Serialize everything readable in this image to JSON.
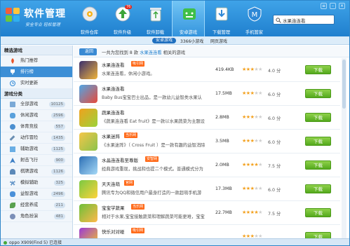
{
  "app": {
    "title": "软件管理",
    "slogan": "安全专业 轻松管理"
  },
  "tabs": [
    {
      "label": "软件仓库",
      "icon": "disc-icon"
    },
    {
      "label": "软件升级",
      "icon": "upgrade-icon",
      "badge": "76"
    },
    {
      "label": "软件卸载",
      "icon": "recycle-bin-icon"
    },
    {
      "label": "安卓游戏",
      "icon": "android-game-icon",
      "active": true
    },
    {
      "label": "下载管理",
      "icon": "download-icon"
    },
    {
      "label": "手机管家",
      "icon": "phone-manager-icon"
    }
  ],
  "search": {
    "value": "水果连连看"
  },
  "subbar": {
    "safe_label": "安卓游戏",
    "count_label": "3366小游戏",
    "web_label": "网页游戏"
  },
  "sidebar": {
    "section1": "精选游戏",
    "featured": [
      {
        "label": "热门推荐"
      },
      {
        "label": "排行榜",
        "selected": true
      },
      {
        "label": "实时更新"
      }
    ],
    "section2": "游戏分类",
    "categories": [
      {
        "label": "全部游戏",
        "count": "10125"
      },
      {
        "label": "休闲游戏",
        "count": "2596"
      },
      {
        "label": "体育竞技",
        "count": "557"
      },
      {
        "label": "动作冒险",
        "count": "1435"
      },
      {
        "label": "辅助游戏",
        "count": "1125"
      },
      {
        "label": "射击飞行",
        "count": "900"
      },
      {
        "label": "棋牌游戏",
        "count": "1126"
      },
      {
        "label": "模拟辅助",
        "count": "325"
      },
      {
        "label": "益智游戏",
        "count": "2496"
      },
      {
        "label": "经营养成",
        "count": "211"
      },
      {
        "label": "角色扮演",
        "count": "481"
      }
    ]
  },
  "crumb": {
    "back": "返回",
    "prefix": "一共为您找到 8 款",
    "keyword": "水果连连看",
    "suffix": "相关的游戏"
  },
  "apps": [
    {
      "name": "水果连连看",
      "tag": "吸引网",
      "desc": "水果连连看，休闲小游戏。",
      "size": "419.4KB",
      "rating": 3,
      "score": "4.0 分",
      "download": "下载",
      "icon_colors": [
        "#3a2e6e",
        "#f0b43a"
      ]
    },
    {
      "name": "水果连连看",
      "tag": "",
      "desc": "Baby Bus宝宝巴士出品，是一款幼儿益智类水果认",
      "size": "17.5MB",
      "rating": 3,
      "score": "6.0 分",
      "download": "下载",
      "icon_colors": [
        "#4fa6e6",
        "#e84a3a"
      ]
    },
    {
      "name": "蔬果连连看",
      "tag": "",
      "desc": "《蔬果连连看 Eat fruit》是一款以水果蔬菜为主题设",
      "size": "2.8MB",
      "rating": 3,
      "score": "6.0 分",
      "download": "下载",
      "icon_colors": [
        "#f0a11e",
        "#9bd33a"
      ]
    },
    {
      "name": "水果迷阵",
      "tag": "当乐网",
      "desc": "《水果迷阵》（ Cross Fruit ）是一款有趣的益智消除",
      "size": "3.5MB",
      "rating": 3,
      "score": "6.0 分",
      "download": "下载",
      "icon_colors": [
        "#f5c64a",
        "#8bc34a"
      ]
    },
    {
      "name": "水晶连连看至尊版",
      "tag": "安智网",
      "desc": "经典游戏重现，挑战和也提二个模式。普通模式分为",
      "size": "2.0MB",
      "rating": 4,
      "score": "7.5 分",
      "download": "下载",
      "icon_colors": [
        "#2d6fb5",
        "#a5d9f7"
      ]
    },
    {
      "name": "天天连萌",
      "tag": "官网",
      "desc": "腾讯专为QQ和微信用户最身打造的一款超萌手机游",
      "size": "17.3MB",
      "rating": 3,
      "score": "6.0 分",
      "download": "下载",
      "icon_colors": [
        "#7ac943",
        "#ffd33a"
      ]
    },
    {
      "name": "宝宝学蔬果",
      "tag": "当乐网",
      "desc": "相对于水果,宝宝接触蔬菜和理解蔬菜可能更难，宝宝",
      "size": "22.7MB",
      "rating": 4,
      "score": "7.5 分",
      "download": "下载",
      "icon_colors": [
        "#6dbf3a",
        "#ffb94a"
      ]
    },
    {
      "name": "快乐对对碰",
      "tag": "吸引网",
      "desc": "",
      "size": "",
      "rating": 3,
      "score": "",
      "download": "下载",
      "icon_colors": [
        "#9b3ad6",
        "#f2c12e"
      ]
    }
  ],
  "status": {
    "device": "oppo X909(Find 5)",
    "state": "已连接"
  },
  "colors": {
    "accent": "#1f7fce",
    "download": "#54a91d",
    "tag": "#ff6a19"
  }
}
